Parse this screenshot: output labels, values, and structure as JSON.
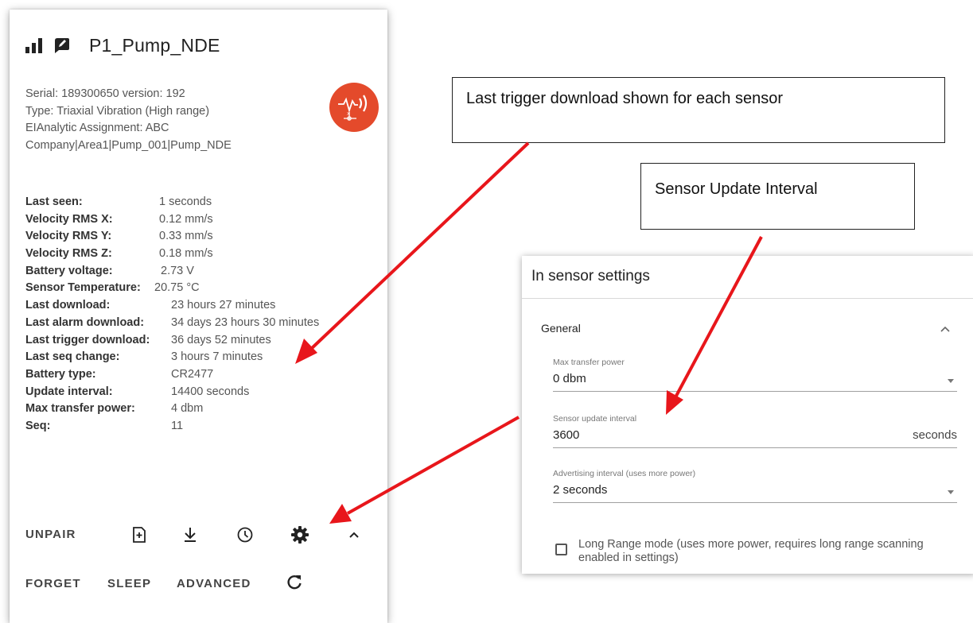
{
  "card": {
    "title": "P1_Pump_NDE",
    "info": [
      "Serial: 189300650 version: 192",
      "Type: Triaxial Vibration (High range)",
      "EIAnalytic Assignment: ABC",
      "Company|Area1|Pump_001|Pump_NDE"
    ],
    "stats": [
      {
        "label": "Last seen:",
        "value": "1 seconds"
      },
      {
        "label": "Velocity RMS X:",
        "value": "0.12 mm/s"
      },
      {
        "label": "Velocity RMS Y:",
        "value": "0.33 mm/s"
      },
      {
        "label": "Velocity RMS Z:",
        "value": "0.18 mm/s"
      },
      {
        "label": "Battery voltage:",
        "value": "2.73 V"
      },
      {
        "label": "Sensor Temperature:",
        "value": "20.75 °C"
      },
      {
        "label": "Last download:",
        "value": "23 hours 27 minutes"
      },
      {
        "label": "Last alarm download:",
        "value": "34 days 23 hours 30 minutes"
      },
      {
        "label": "Last trigger download:",
        "value": "36 days 52 minutes"
      },
      {
        "label": "Last seq change:",
        "value": "3 hours 7 minutes"
      },
      {
        "label": "Battery type:",
        "value": "CR2477"
      },
      {
        "label": "Update interval:",
        "value": "14400 seconds"
      },
      {
        "label": "Max transfer power:",
        "value": "4 dbm"
      },
      {
        "label": "Seq:",
        "value": "11"
      }
    ],
    "actions": {
      "unpair": "UNPAIR",
      "forget": "FORGET",
      "sleep": "SLEEP",
      "advanced": "ADVANCED"
    },
    "icons": [
      "signal-bars-icon",
      "edit-note-icon",
      "vibration-sensor-icon",
      "add-file-icon",
      "download-icon",
      "history-clock-icon",
      "gear-icon",
      "chevron-up-icon",
      "refresh-icon"
    ],
    "accent_color": "#e44a2b"
  },
  "callouts": {
    "trigger": "Last trigger download shown for each sensor",
    "interval": "Sensor Update Interval"
  },
  "settings": {
    "title": "In sensor settings",
    "section": "General",
    "max_transfer_power": {
      "label": "Max transfer power",
      "value": "0 dbm"
    },
    "sensor_update_interval": {
      "label": "Sensor update interval",
      "value": "3600",
      "suffix": "seconds"
    },
    "advertising_interval": {
      "label": "Advertising interval (uses more power)",
      "value": "2 seconds"
    },
    "long_range": {
      "label": "Long Range mode (uses more power, requires long range scanning enabled in settings)",
      "checked": false
    }
  },
  "arrow_color": "#e8161b"
}
